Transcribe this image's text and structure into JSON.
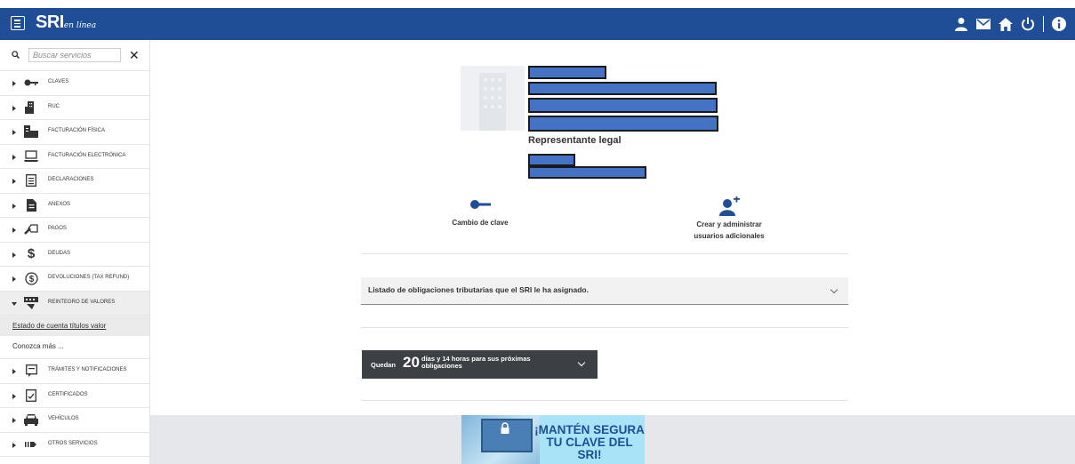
{
  "header": {
    "logo": "SRI",
    "logo_suffix": "en línea",
    "icons": [
      "user-icon",
      "mail-icon",
      "home-icon",
      "power-icon",
      "info-icon"
    ],
    "bg_color": "#1f4e96"
  },
  "sidebar": {
    "search_placeholder": "Buscar servicios",
    "close": "✕",
    "items": [
      {
        "label": "CLAVES",
        "icon": "key-icon"
      },
      {
        "label": "RUC",
        "icon": "building-icon"
      },
      {
        "label": "FACTURACIÓN FÍSICA",
        "icon": "invoice-icon"
      },
      {
        "label": "FACTURACIÓN ELECTRÓNICA",
        "icon": "laptop-icon"
      },
      {
        "label": "DECLARACIONES",
        "icon": "document-icon"
      },
      {
        "label": "ANEXOS",
        "icon": "file-icon"
      },
      {
        "label": "PAGOS",
        "icon": "payment-icon"
      },
      {
        "label": "DEUDAS",
        "icon": "dollar-icon"
      },
      {
        "label": "DEVOLUCIONES (TAX REFUND)",
        "icon": "refund-icon"
      },
      {
        "label": "REINTEGRO DE VALORES",
        "icon": "reintegro-icon",
        "expanded": true
      },
      {
        "label": "TRÁMITES Y NOTIFICACIONES",
        "icon": "tramites-icon"
      },
      {
        "label": "CERTIFICADOS",
        "icon": "certificate-icon"
      },
      {
        "label": "VEHÍCULOS",
        "icon": "car-icon"
      },
      {
        "label": "OTROS SERVICIOS",
        "icon": "arrow-icon"
      }
    ],
    "subitems": [
      "Estado de cuenta títulos valor",
      "Conozca más ..."
    ]
  },
  "profile": {
    "role": "Representante legal"
  },
  "actions": {
    "change_password": "Cambio de clave",
    "create_users_line1": "Crear y administrar",
    "create_users_line2": "usuarios adicionales"
  },
  "obligations": {
    "title": "Listado de obligaciones tributarias que el SRI le ha asignado."
  },
  "countdown": {
    "prefix": "Quedan",
    "days": "20",
    "suffix_line1": "días y 14 horas para sus próximas",
    "suffix_line2": "obligaciones"
  },
  "banner": {
    "line1": "¡MANTÉN SEGURA",
    "line2": "TU CLAVE DEL SRI!"
  }
}
